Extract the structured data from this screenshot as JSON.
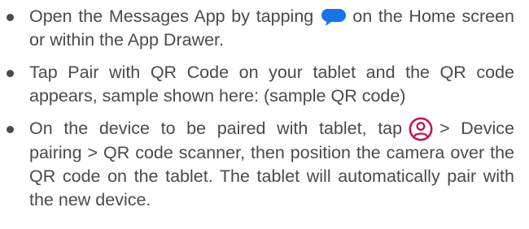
{
  "items": [
    {
      "before": "Open the Messages App by tapping",
      "icon": "messages-bubble-icon",
      "after": "on the Home screen or within the App Drawer."
    },
    {
      "text": "Tap Pair with QR Code on your tablet and the QR code appears, sample shown here: (sample QR code)"
    },
    {
      "before": "On the device to be paired with tablet, tap",
      "icon": "account-circle-icon",
      "after": "> Device pairing > QR code scanner, then position the camera over the QR code on the tablet. The tablet will automatically pair with the new device."
    }
  ],
  "colors": {
    "text": "#4a4a4a",
    "messages_icon": "#1a73e8",
    "account_icon": "#c2185b"
  }
}
